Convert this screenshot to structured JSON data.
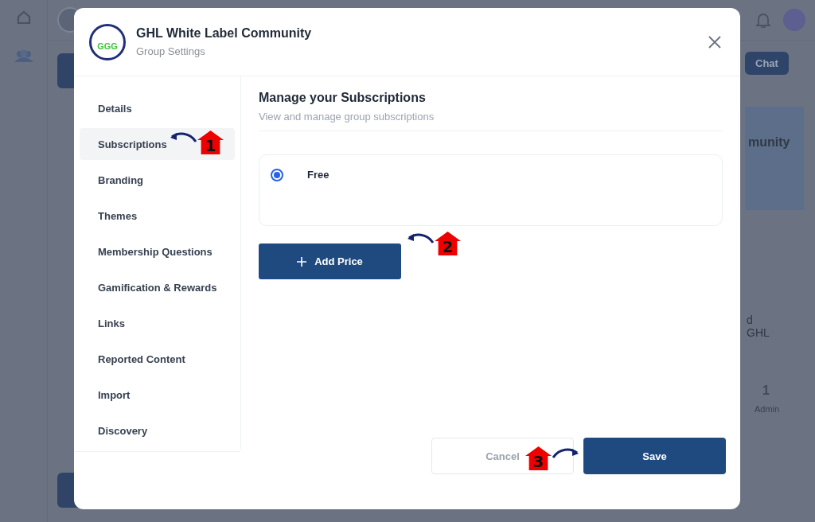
{
  "background": {
    "chat_button": "Chat",
    "banner_text": "munity",
    "texts": [
      "d",
      "GHL"
    ],
    "stat": {
      "value": "1",
      "label": "Admin"
    }
  },
  "dialog": {
    "logo_text": "GGG",
    "title": "GHL White Label Community",
    "subtitle": "Group Settings",
    "sidebar": {
      "items": [
        {
          "label": "Details",
          "selected": false
        },
        {
          "label": "Subscriptions",
          "selected": true
        },
        {
          "label": "Branding",
          "selected": false
        },
        {
          "label": "Themes",
          "selected": false
        },
        {
          "label": "Membership Questions",
          "selected": false
        },
        {
          "label": "Gamification & Rewards",
          "selected": false
        },
        {
          "label": "Links",
          "selected": false
        },
        {
          "label": "Reported Content",
          "selected": false
        },
        {
          "label": "Import",
          "selected": false
        },
        {
          "label": "Discovery",
          "selected": false
        }
      ]
    },
    "content": {
      "title": "Manage your Subscriptions",
      "subtitle": "View and manage group subscriptions",
      "plans": [
        {
          "name": "Free",
          "selected": true
        }
      ],
      "add_button": "Add Price"
    },
    "buttons": {
      "cancel": "Cancel",
      "save": "Save"
    }
  },
  "annotations": [
    {
      "number": "1",
      "kind": "left"
    },
    {
      "number": "2",
      "kind": "left"
    },
    {
      "number": "3",
      "kind": "right"
    }
  ]
}
